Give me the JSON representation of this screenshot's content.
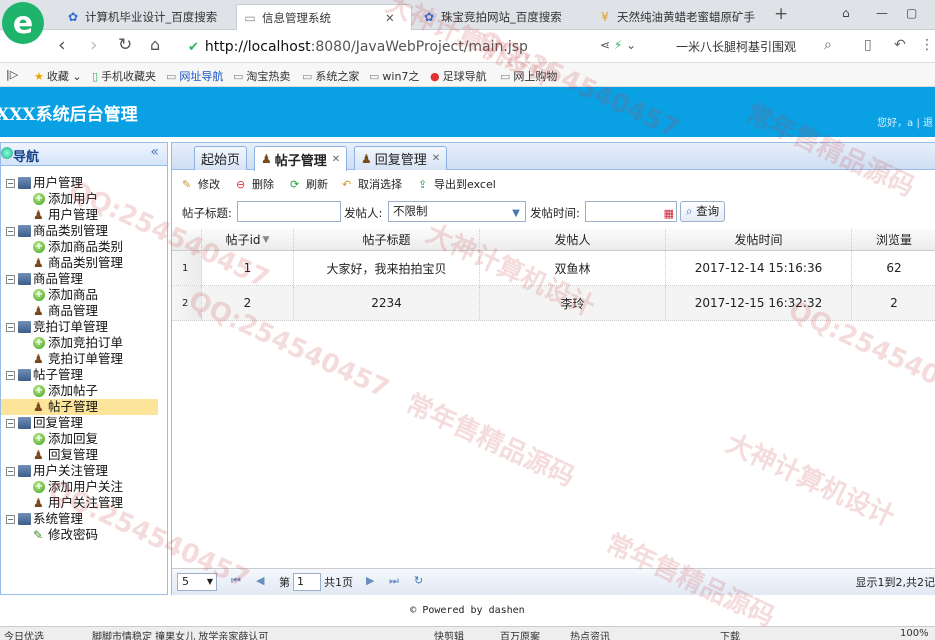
{
  "browser": {
    "tabs": [
      {
        "label": "计算机毕业设计_百度搜索",
        "icon": "paw-icon",
        "active": false
      },
      {
        "label": "信息管理系统",
        "icon": "page-icon",
        "active": true
      },
      {
        "label": "珠宝竞拍网站_百度搜索",
        "icon": "paw-icon",
        "active": false
      },
      {
        "label": "天然纯油黄蜡老蜜蜡原矿手",
        "icon": "shop-icon",
        "active": false
      }
    ],
    "url_host": "http://localhost",
    "url_rest": ":8080/JavaWebProject/main.jsp",
    "search_hint": "一米八长腿柯基引围观",
    "bookmarks": [
      "收藏",
      "手机收藏夹",
      "网址导航",
      "淘宝热卖",
      "系统之家",
      "win7之",
      "足球导航",
      "网上购物"
    ]
  },
  "app": {
    "title": "XXX系统后台管理",
    "greeting": "您好，a  |  退"
  },
  "sidebar": {
    "title": "导航",
    "groups": [
      {
        "label": "用户管理",
        "items": [
          {
            "label": "添加用户",
            "icon": "add-icon"
          },
          {
            "label": "用户管理",
            "icon": "user-icon"
          }
        ]
      },
      {
        "label": "商品类别管理",
        "items": [
          {
            "label": "添加商品类别",
            "icon": "add-icon"
          },
          {
            "label": "商品类别管理",
            "icon": "user-icon"
          }
        ]
      },
      {
        "label": "商品管理",
        "items": [
          {
            "label": "添加商品",
            "icon": "add-icon"
          },
          {
            "label": "商品管理",
            "icon": "user-icon"
          }
        ]
      },
      {
        "label": "竞拍订单管理",
        "items": [
          {
            "label": "添加竞拍订单",
            "icon": "add-icon"
          },
          {
            "label": "竞拍订单管理",
            "icon": "user-icon"
          }
        ]
      },
      {
        "label": "帖子管理",
        "items": [
          {
            "label": "添加帖子",
            "icon": "add-icon"
          },
          {
            "label": "帖子管理",
            "icon": "user-icon",
            "selected": true
          }
        ]
      },
      {
        "label": "回复管理",
        "items": [
          {
            "label": "添加回复",
            "icon": "add-icon"
          },
          {
            "label": "回复管理",
            "icon": "user-icon"
          }
        ]
      },
      {
        "label": "用户关注管理",
        "items": [
          {
            "label": "添加用户关注",
            "icon": "add-icon"
          },
          {
            "label": "用户关注管理",
            "icon": "user-icon"
          }
        ]
      },
      {
        "label": "系统管理",
        "items": [
          {
            "label": "修改密码",
            "icon": "pencil-icon"
          }
        ]
      }
    ]
  },
  "tabs": [
    {
      "label": "起始页"
    },
    {
      "label": "帖子管理",
      "active": true
    },
    {
      "label": "回复管理"
    }
  ],
  "toolbar": {
    "edit": "修改",
    "delete": "删除",
    "refresh": "刷新",
    "cancel_select": "取消选择",
    "export": "导出到excel"
  },
  "search": {
    "title_label": "帖子标题:",
    "title_value": "",
    "poster_label": "发帖人:",
    "poster_value": "不限制",
    "time_label": "发帖时间:",
    "time_value": "",
    "query_button": "查询"
  },
  "grid": {
    "columns": [
      "帖子id",
      "帖子标题",
      "发帖人",
      "发帖时间",
      "浏览量"
    ],
    "rows": [
      {
        "num": "1",
        "id": "1",
        "title": "大家好，我来拍拍宝贝",
        "poster": "双鱼林",
        "time": "2017-12-14 15:16:36",
        "views": "62"
      },
      {
        "num": "2",
        "id": "2",
        "title": "2234",
        "poster": "李玲",
        "time": "2017-12-15 16:32:32",
        "views": "2"
      }
    ]
  },
  "pager": {
    "page_size": "5",
    "page_prefix": "第",
    "page_num": "1",
    "page_suffix": "共1页",
    "summary": "显示1到2,共2记"
  },
  "footer": "© Powered by dashen",
  "statusbar": [
    "今日优选",
    "脚脚市情稳定 撞果女儿 放学亲家薛认可",
    "快剪辑",
    "百万原案",
    "热点资讯",
    "下载",
    "100%"
  ],
  "watermarks": [
    "大神计算机设计",
    "QQ:254540457",
    "常年售精品源码",
    "QQ:254540457",
    "大神计算机设计",
    "QQ:254540457",
    "常年售精品源码",
    "QQ:254540457",
    "大神计算机设计",
    "QQ:254540457",
    "常年售精品源码"
  ]
}
